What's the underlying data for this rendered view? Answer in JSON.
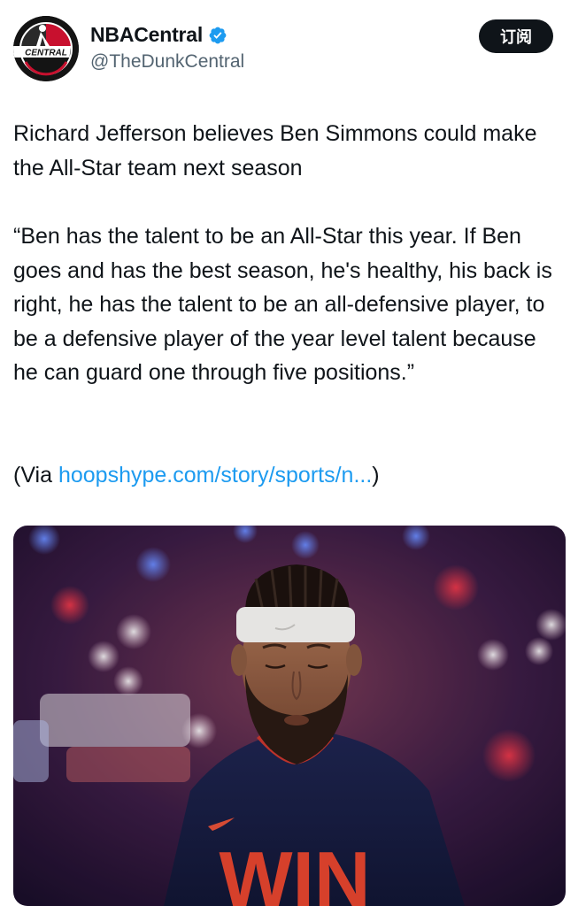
{
  "author": {
    "display_name": "NBACentral",
    "handle": "@TheDunkCentral",
    "avatar_text": "CENTRAL",
    "verified_icon": "verified-badge-icon"
  },
  "actions": {
    "subscribe_label": "订阅"
  },
  "tweet": {
    "headline": "Richard Jefferson believes Ben Simmons could make the All-Star team next season",
    "quote": "“Ben has the talent to be an All-Star this year. If Ben goes and has the best season, he's healthy, his back is right, he has the talent to be an all-defensive player, to be a defensive player of the year level talent because he can guard one through five positions.”",
    "via_prefix": "(Via ",
    "via_link": "hoopshype.com/story/sports/n...",
    "via_suffix": ")"
  },
  "media": {
    "shirt_text": "WIN"
  },
  "colors": {
    "link": "#1d9bf0",
    "verified": "#1d9bf0",
    "button_bg": "#0f1419",
    "handle": "#536471"
  }
}
